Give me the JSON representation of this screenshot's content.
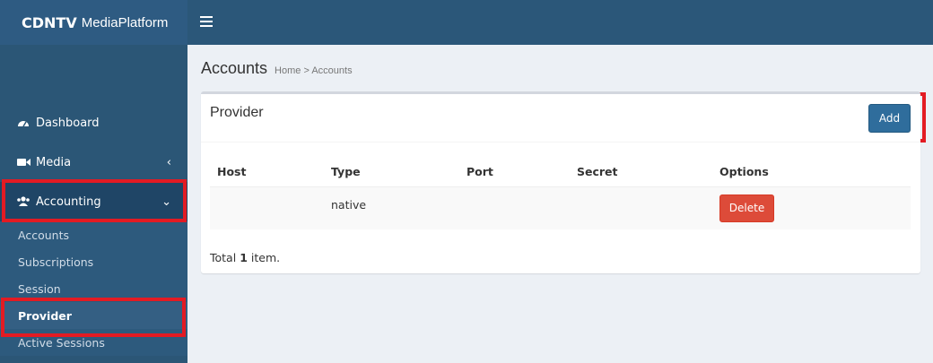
{
  "header": {
    "brand_bold": "CDNTV",
    "brand_rest": "MediaPlatform",
    "menu_icon": "hamburger-icon"
  },
  "sidebar": {
    "items": [
      {
        "label": "Dashboard",
        "icon": "dashboard-icon"
      },
      {
        "label": "Media",
        "icon": "video-camera-icon",
        "chevron": "‹"
      },
      {
        "label": "Accounting",
        "icon": "users-icon",
        "chevron": "⌄"
      }
    ],
    "submenu": [
      {
        "label": "Accounts"
      },
      {
        "label": "Subscriptions"
      },
      {
        "label": "Session"
      },
      {
        "label": "Provider"
      },
      {
        "label": "Active Sessions"
      }
    ]
  },
  "page": {
    "title": "Accounts",
    "breadcrumb": "Home > Accounts"
  },
  "box": {
    "title": "Provider",
    "add_label": "Add"
  },
  "table": {
    "headers": [
      "Host",
      "Type",
      "Port",
      "Secret",
      "Options"
    ],
    "rows": [
      {
        "host": "",
        "type": "native",
        "port": "",
        "secret": "",
        "delete_label": "Delete"
      }
    ]
  },
  "summary": {
    "prefix": "Total",
    "count": "1",
    "suffix": "item."
  },
  "colors": {
    "header_bg": "#2b5779",
    "sidebar_bg": "#2b5676",
    "primary_button": "#2f6d9c",
    "danger_button": "#dd4b39",
    "highlight": "#e31b23"
  }
}
